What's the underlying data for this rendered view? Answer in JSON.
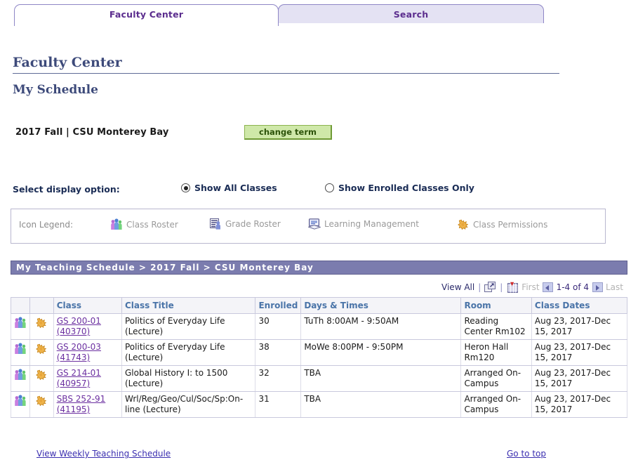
{
  "tabs": [
    {
      "label": "Faculty Center",
      "active": true
    },
    {
      "label": "Search",
      "active": false
    }
  ],
  "page": {
    "title": "Faculty Center",
    "subtitle": "My Schedule"
  },
  "term": {
    "text": "2017 Fall | CSU Monterey Bay",
    "change_button": "change term"
  },
  "display_option": {
    "label": "Select display option:",
    "options": [
      {
        "label": "Show All Classes",
        "selected": true
      },
      {
        "label": "Show Enrolled Classes Only",
        "selected": false
      }
    ]
  },
  "legend": {
    "label": "Icon Legend:",
    "items": [
      {
        "icon": "class-roster-icon",
        "label": "Class Roster"
      },
      {
        "icon": "grade-roster-icon",
        "label": "Grade Roster"
      },
      {
        "icon": "learning-management-icon",
        "label": "Learning Management"
      },
      {
        "icon": "class-permissions-icon",
        "label": "Class Permissions"
      }
    ]
  },
  "schedule": {
    "header": "My Teaching Schedule > 2017 Fall > CSU Monterey Bay",
    "toolbar": {
      "view_all": "View All",
      "separator": "|",
      "popup_icon": "new-window-icon",
      "download_icon": "download-spreadsheet-icon",
      "first": "First",
      "prev_icon": "prev-page-arrow-icon",
      "range": "1-4 of 4",
      "next_icon": "next-page-arrow-icon",
      "last": "Last"
    },
    "columns": [
      "",
      "",
      "Class",
      "Class Title",
      "Enrolled",
      "Days & Times",
      "Room",
      "Class Dates"
    ],
    "rows": [
      {
        "roster_icon": "class-roster-icon",
        "permissions_icon": "class-permissions-icon",
        "class": "GS 200-01",
        "class_nbr": "(40370)",
        "title": "Politics of Everyday Life (Lecture)",
        "enrolled": "30",
        "days_times": "TuTh 8:00AM - 9:50AM",
        "room": "Reading Center Rm102",
        "dates": "Aug 23, 2017-Dec 15, 2017"
      },
      {
        "roster_icon": "class-roster-icon",
        "permissions_icon": "class-permissions-icon",
        "class": "GS 200-03",
        "class_nbr": "(41743)",
        "title": "Politics of Everyday Life (Lecture)",
        "enrolled": "38",
        "days_times": "MoWe 8:00PM - 9:50PM",
        "room": "Heron Hall Rm120",
        "dates": "Aug 23, 2017-Dec 15, 2017"
      },
      {
        "roster_icon": "class-roster-icon",
        "permissions_icon": "class-permissions-icon",
        "class": "GS 214-01",
        "class_nbr": "(40957)",
        "title": "Global History I: to 1500 (Lecture)",
        "enrolled": "32",
        "days_times": "TBA",
        "room": "Arranged On-Campus",
        "dates": "Aug 23, 2017-Dec 15, 2017"
      },
      {
        "roster_icon": "class-roster-icon",
        "permissions_icon": "class-permissions-icon",
        "class": "SBS 252-91",
        "class_nbr": "(41195)",
        "title": "Wrl/Reg/Geo/Cul/Soc/Sp:On-line (Lecture)",
        "enrolled": "31",
        "days_times": "TBA",
        "room": "Arranged On-Campus",
        "dates": "Aug 23, 2017-Dec 15, 2017"
      }
    ]
  },
  "footer": {
    "left_link": "View Weekly Teaching Schedule",
    "right_link": "Go to top"
  },
  "colors": {
    "tab_border": "#8e86c6",
    "tab_text": "#5b2d8e",
    "tab_inactive_bg": "#e4e2f3",
    "heading": "#3d4a7a",
    "button_green_bg": "#cfe8a9",
    "button_green_text": "#2c5209",
    "bar_purple": "#7b7cae",
    "col_header_text": "#4a74a8",
    "link_purple": "#6b2fa0",
    "footer_link": "#3b2fb0"
  }
}
